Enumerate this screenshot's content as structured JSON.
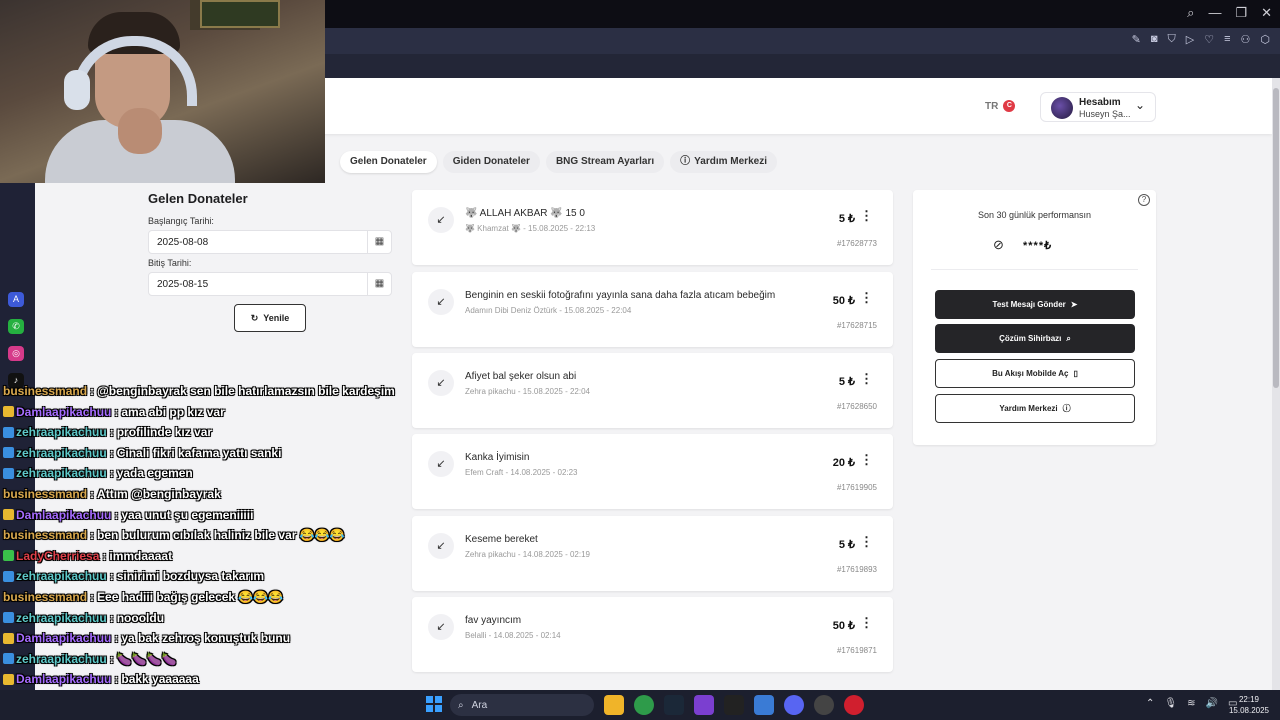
{
  "site": {
    "lang": "TR",
    "lang_flag": "C",
    "account": {
      "title": "Hesabım",
      "user": "Huseyn Şa..."
    }
  },
  "nav": {
    "stub": "ı",
    "tabs": [
      {
        "label": "Gelen Donateler",
        "active": true
      },
      {
        "label": "Giden Donateler",
        "active": false
      },
      {
        "label": "BNG Stream Ayarları",
        "active": false
      },
      {
        "label": "Yardım Merkezi",
        "active": false
      }
    ]
  },
  "filters": {
    "title": "Gelen Donateler",
    "start_label": "Başlangıç Tarihi:",
    "start_value": "2025-08-08",
    "end_label": "Bitiş Tarihi:",
    "end_value": "2025-08-15",
    "refresh_label": "Yenile"
  },
  "donations": [
    {
      "message": "🐺 ALLAH AKBAR 🐺 15 0",
      "meta": "🐺 Khamzat 🐺 - 15.08.2025 - 22:13",
      "amount": "5 ₺",
      "id": "#17628773"
    },
    {
      "message": "Benginin en seskii fotoğrafını yayınla sana daha fazla atıcam bebeğim",
      "meta": "Adamın Dibi Deniz Öztürk - 15.08.2025 - 22:04",
      "amount": "50 ₺",
      "id": "#17628715"
    },
    {
      "message": "Afiyet bal şeker olsun abi",
      "meta": "Zehra pikachu - 15.08.2025 - 22:04",
      "amount": "5 ₺",
      "id": "#17628650"
    },
    {
      "message": "Kanka İyimisin",
      "meta": "Efem Craft - 14.08.2025 - 02:23",
      "amount": "20 ₺",
      "id": "#17619905"
    },
    {
      "message": "Keseme bereket",
      "meta": "Zehra pikachu - 14.08.2025 - 02:19",
      "amount": "5 ₺",
      "id": "#17619893"
    },
    {
      "message": "fav yayıncım",
      "meta": "Belalli - 14.08.2025 - 02:14",
      "amount": "50 ₺",
      "id": "#17619871"
    }
  ],
  "panel": {
    "title": "Son 30 günlük performansın",
    "hidden_value": "****₺",
    "buttons": [
      {
        "label": "Test Mesajı Gönder",
        "icon": "send-icon",
        "style": "dark"
      },
      {
        "label": "Çözüm Sihirbazı",
        "icon": "search-icon",
        "style": "dark"
      },
      {
        "label": "Bu Akışı Mobilde Aç",
        "icon": "phone-icon",
        "style": "light"
      },
      {
        "label": "Yardım Merkezi",
        "icon": "help-icon",
        "style": "light"
      }
    ]
  },
  "chat": [
    {
      "user": "businessmand",
      "color": "#d9a84e",
      "text": "@benginbayrak sen bile hatırlamazsın bile kardeşim",
      "badge": ""
    },
    {
      "user": "Damlaapikachuu",
      "color": "#a66cff",
      "text": "ama abi pp kız var",
      "badge": "#e8b830"
    },
    {
      "user": "zehraapikachuu",
      "color": "#5ec9c9",
      "text": "profilinde kız var",
      "badge": "#3a8fe0"
    },
    {
      "user": "zehraapikachuu",
      "color": "#5ec9c9",
      "text": "Cinali fikri kafama yattı sanki",
      "badge": "#3a8fe0"
    },
    {
      "user": "zehraapikachuu",
      "color": "#5ec9c9",
      "text": "yada egemen",
      "badge": "#3a8fe0"
    },
    {
      "user": "businessmand",
      "color": "#d9a84e",
      "text": "Attım @benginbayrak",
      "badge": ""
    },
    {
      "user": "Damlaapikachuu",
      "color": "#a66cff",
      "text": "yaa unut şu egemeniiiii",
      "badge": "#e8b830"
    },
    {
      "user": "businessmand",
      "color": "#d9a84e",
      "text": "ben bulurum cıbılak haliniz bile var 😂😂😂",
      "badge": ""
    },
    {
      "user": "LadyCherriesa",
      "color": "#e0404a",
      "text": "immdaaaat",
      "badge": "#3ac04a"
    },
    {
      "user": "zehraapikachuu",
      "color": "#5ec9c9",
      "text": "sinirimi bozduysa takarım",
      "badge": "#3a8fe0"
    },
    {
      "user": "businessmand",
      "color": "#d9a84e",
      "text": "Eee hadiii bağış gelecek 😂😂😂",
      "badge": ""
    },
    {
      "user": "zehraapikachuu",
      "color": "#5ec9c9",
      "text": "noooldu",
      "badge": "#3a8fe0"
    },
    {
      "user": "Damlaapikachuu",
      "color": "#a66cff",
      "text": "ya bak zehroş konuştuk bunu",
      "badge": "#e8b830"
    },
    {
      "user": "zehraapikachuu",
      "color": "#5ec9c9",
      "text": "🍆🍆🍆🍆",
      "badge": "#3a8fe0"
    },
    {
      "user": "Damlaapikachuu",
      "color": "#a66cff",
      "text": "bakk yaaaaaa",
      "badge": "#e8b830"
    }
  ],
  "taskbar": {
    "search_placeholder": "Ara",
    "time": "22:19",
    "date": "15.08.2025"
  }
}
